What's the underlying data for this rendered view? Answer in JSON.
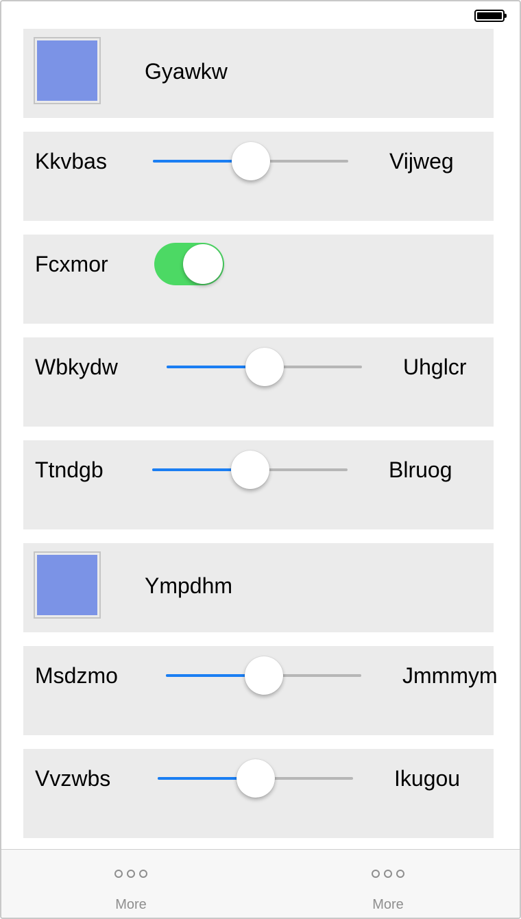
{
  "rows": [
    {
      "type": "swatch",
      "label": "Gyawkw",
      "color": "#7b93e6"
    },
    {
      "type": "slider",
      "left_label": "Kkvbas",
      "right_label": "Vijweg",
      "value": 0.5
    },
    {
      "type": "toggle",
      "label": "Fcxmor",
      "on": true
    },
    {
      "type": "slider",
      "left_label": "Wbkydw",
      "right_label": "Uhglcr",
      "value": 0.5
    },
    {
      "type": "slider",
      "left_label": "Ttndgb",
      "right_label": "Blruog",
      "value": 0.5
    },
    {
      "type": "swatch",
      "label": "Ympdhm",
      "color": "#7b93e6"
    },
    {
      "type": "slider",
      "left_label": "Msdzmo",
      "right_label": "Jmmmym",
      "value": 0.5
    },
    {
      "type": "slider",
      "left_label": "Vvzwbs",
      "right_label": "Ikugou",
      "value": 0.5
    }
  ],
  "tabbar": {
    "tabs": [
      {
        "label": "More",
        "icon": "more-icon"
      },
      {
        "label": "More",
        "icon": "more-icon"
      }
    ]
  },
  "colors": {
    "accent": "#1a7ef3",
    "toggle_on": "#4cd964",
    "row_background": "#ebebeb"
  }
}
